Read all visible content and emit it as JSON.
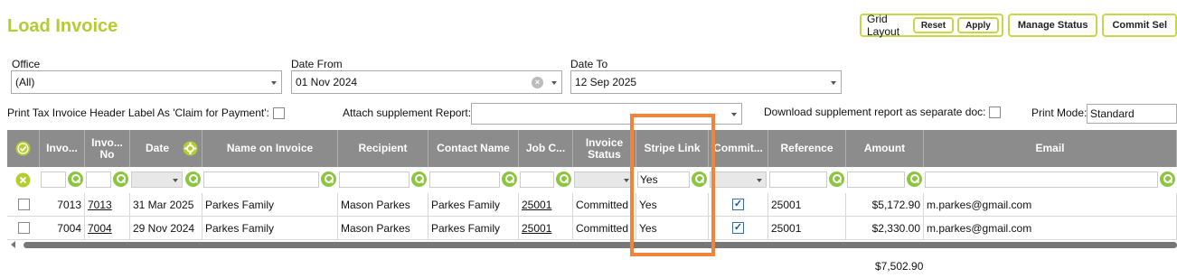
{
  "page": {
    "title": "Load Invoice"
  },
  "toolbar": {
    "grid_layout_label": "Grid Layout",
    "reset_label": "Reset",
    "apply_label": "Apply",
    "manage_status_label": "Manage Status",
    "commit_label": "Commit Sel"
  },
  "filters": {
    "office": {
      "label": "Office",
      "value": "(All)"
    },
    "date_from": {
      "label": "Date From",
      "value": "01 Nov 2024"
    },
    "date_to": {
      "label": "Date To",
      "value": "12 Sep 2025"
    }
  },
  "options": {
    "print_header_label": "Print Tax Invoice Header Label As 'Claim for Payment':",
    "attach_supplement_label": "Attach supplement Report:",
    "attach_supplement_value": "",
    "download_separate_label": "Download supplement report as separate doc:",
    "print_mode_label": "Print Mode:",
    "print_mode_value": "Standard"
  },
  "grid": {
    "columns": [
      "Invo...",
      "Invo... No",
      "Date",
      "Name on Invoice",
      "Recipient",
      "Contact Name",
      "Job C...",
      "Invoice Status",
      "Stripe Link",
      "Commit...",
      "Reference",
      "Amount",
      "Email"
    ],
    "stripe_filter_value": "Yes",
    "rows": [
      {
        "invoice": "7013",
        "invoice_no": "7013",
        "date": "31 Mar 2025",
        "name_on_invoice": "Parkes Family",
        "recipient": "Mason Parkes",
        "contact_name": "Parkes Family",
        "job_code": "25001",
        "status": "Committed",
        "stripe_link": "Yes",
        "committed": true,
        "reference": "25001",
        "amount": "$5,172.90",
        "email": "m.parkes@gmail.com"
      },
      {
        "invoice": "7004",
        "invoice_no": "7004",
        "date": "29 Nov 2024",
        "name_on_invoice": "Parkes Family",
        "recipient": "Mason Parkes",
        "contact_name": "Parkes Family",
        "job_code": "25001",
        "status": "Committed",
        "stripe_link": "Yes",
        "committed": true,
        "reference": "25001",
        "amount": "$2,330.00",
        "email": "m.parkes@gmail.com"
      }
    ],
    "total_amount": "$7,502.90"
  },
  "colors": {
    "accent": "#b5cc2f",
    "header_bg": "#8c8c8c",
    "highlight": "#f0843a"
  }
}
